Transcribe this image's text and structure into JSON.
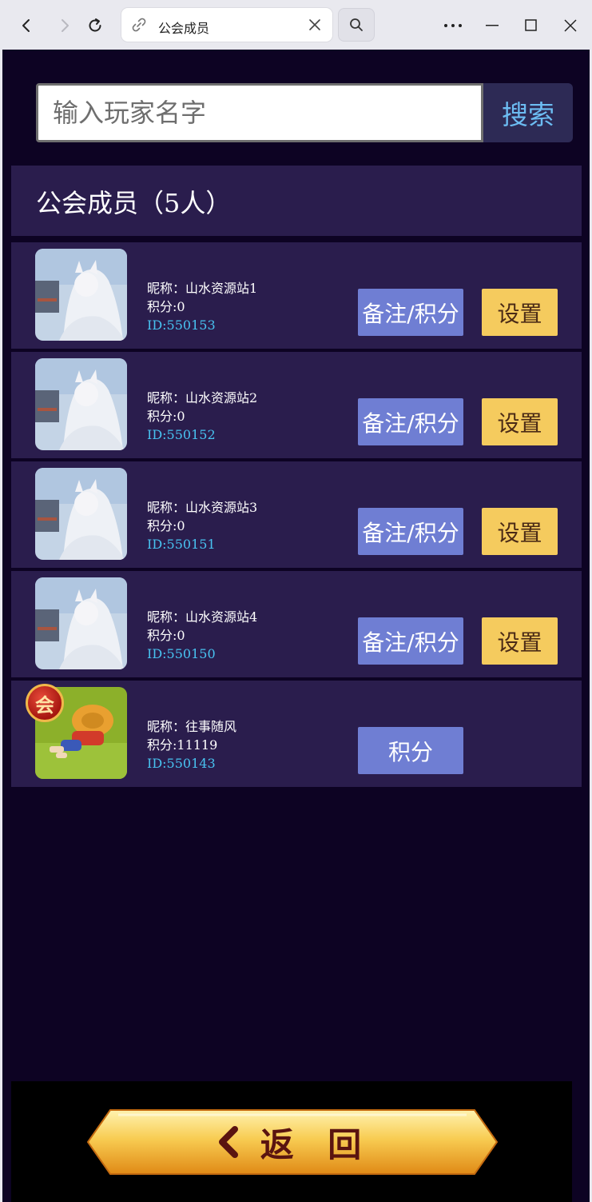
{
  "browser": {
    "tab_title": "公会成员",
    "icons": [
      "back-icon",
      "forward-icon",
      "reload-icon",
      "link-icon",
      "close-icon",
      "search-icon",
      "more-icon",
      "minimize-icon",
      "maximize-icon",
      "window-close-icon"
    ]
  },
  "search": {
    "placeholder": "输入玩家名字",
    "button_label": "搜索"
  },
  "header": {
    "title": "公会成员（5人）"
  },
  "members": [
    {
      "nickname": "昵称：山水资源站1",
      "score": "积分:0",
      "id": "ID:550153",
      "note_label": "备注/积分",
      "settings_label": "设置"
    },
    {
      "nickname": "昵称：山水资源站2",
      "score": "积分:0",
      "id": "ID:550152",
      "note_label": "备注/积分",
      "settings_label": "设置"
    },
    {
      "nickname": "昵称：山水资源站3",
      "score": "积分:0",
      "id": "ID:550151",
      "note_label": "备注/积分",
      "settings_label": "设置"
    },
    {
      "nickname": "昵称：山水资源站4",
      "score": "积分:0",
      "id": "ID:550150",
      "note_label": "备注/积分",
      "settings_label": "设置"
    },
    {
      "nickname": "昵称：往事随风",
      "score": "积分:11119",
      "id": "ID:550143",
      "note_label": "积分",
      "badge": "会"
    }
  ],
  "footer": {
    "back_label": "返 回"
  },
  "colors": {
    "background": "#0d0323",
    "row": "#2a1d4d",
    "note_button": "#6f7ed3",
    "settings_button": "#f5cb5e",
    "id_text": "#48c2f0",
    "search_text": "#6cbcf2"
  }
}
